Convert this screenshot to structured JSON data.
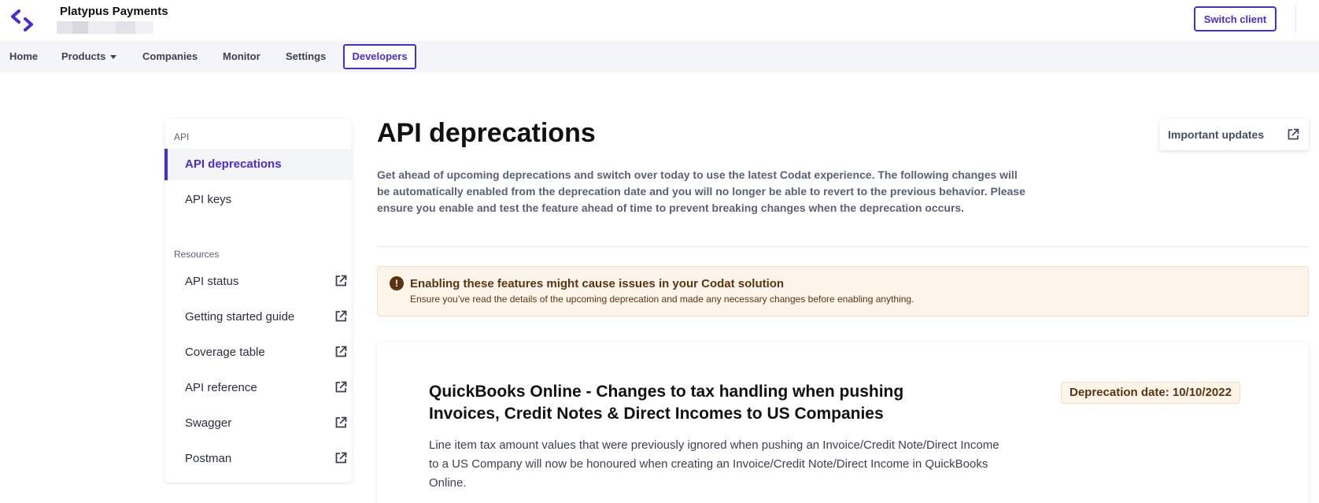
{
  "header": {
    "client_name": "Platypus Payments",
    "switch_label": "Switch client"
  },
  "nav": {
    "items": [
      "Home",
      "Products",
      "Companies",
      "Monitor",
      "Settings"
    ],
    "active": "Developers"
  },
  "sidebar": {
    "section_api": "API",
    "api_items": [
      "API deprecations",
      "API keys"
    ],
    "section_resources": "Resources",
    "resource_items": [
      "API status",
      "Getting started guide",
      "Coverage table",
      "API reference",
      "Swagger",
      "Postman"
    ]
  },
  "main": {
    "title": "API deprecations",
    "updates_label": "Important updates",
    "intro": "Get ahead of upcoming deprecations and switch over today to use the latest Codat experience. The following changes will be automatically enabled from the deprecation date and you will no longer be able to revert to the previous behavior. Please ensure you enable and test the feature ahead of time to prevent breaking changes when the deprecation occurs.",
    "warning": {
      "icon": "!",
      "title": "Enabling these features might cause issues in your Codat solution",
      "text": "Ensure you’ve read the details of the upcoming deprecation and made any necessary changes before enabling anything."
    },
    "card": {
      "title": "QuickBooks Online - Changes to tax handling when pushing Invoices, Credit Notes & Direct Incomes to US Companies",
      "badge": "Deprecation date: 10/10/2022",
      "text": "Line item tax amount values that were previously ignored when pushing an Invoice/Credit Note/Direct Income to a US Company will now be honoured when creating an Invoice/Credit Note/Direct Income in QuickBooks Online."
    }
  },
  "colors": {
    "accent": "#4a2cd6",
    "warning_bg": "#fef5ea",
    "warning_text": "#5a3410"
  }
}
